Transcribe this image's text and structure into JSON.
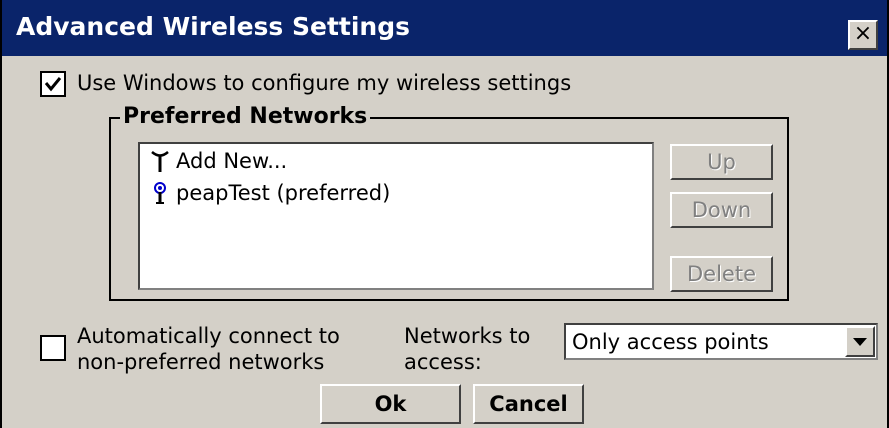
{
  "window": {
    "title": "Advanced Wireless Settings",
    "close_label": "×"
  },
  "use_windows": {
    "checked": true,
    "label": "Use Windows to configure my wireless settings"
  },
  "preferred_networks": {
    "legend": "Preferred Networks",
    "items": [
      {
        "icon": "antenna-icon",
        "label": "Add New..."
      },
      {
        "icon": "wireless-network-icon",
        "label": "peapTest (preferred)"
      }
    ],
    "buttons": {
      "up": "Up",
      "down": "Down",
      "delete": "Delete"
    }
  },
  "auto_connect": {
    "checked": false,
    "label_line1": "Automatically connect to",
    "label_line2": "non-preferred networks"
  },
  "networks_to_access": {
    "label_line1": "Networks to",
    "label_line2": "access:",
    "selected": "Only access points"
  },
  "footer": {
    "ok": "Ok",
    "cancel": "Cancel"
  }
}
